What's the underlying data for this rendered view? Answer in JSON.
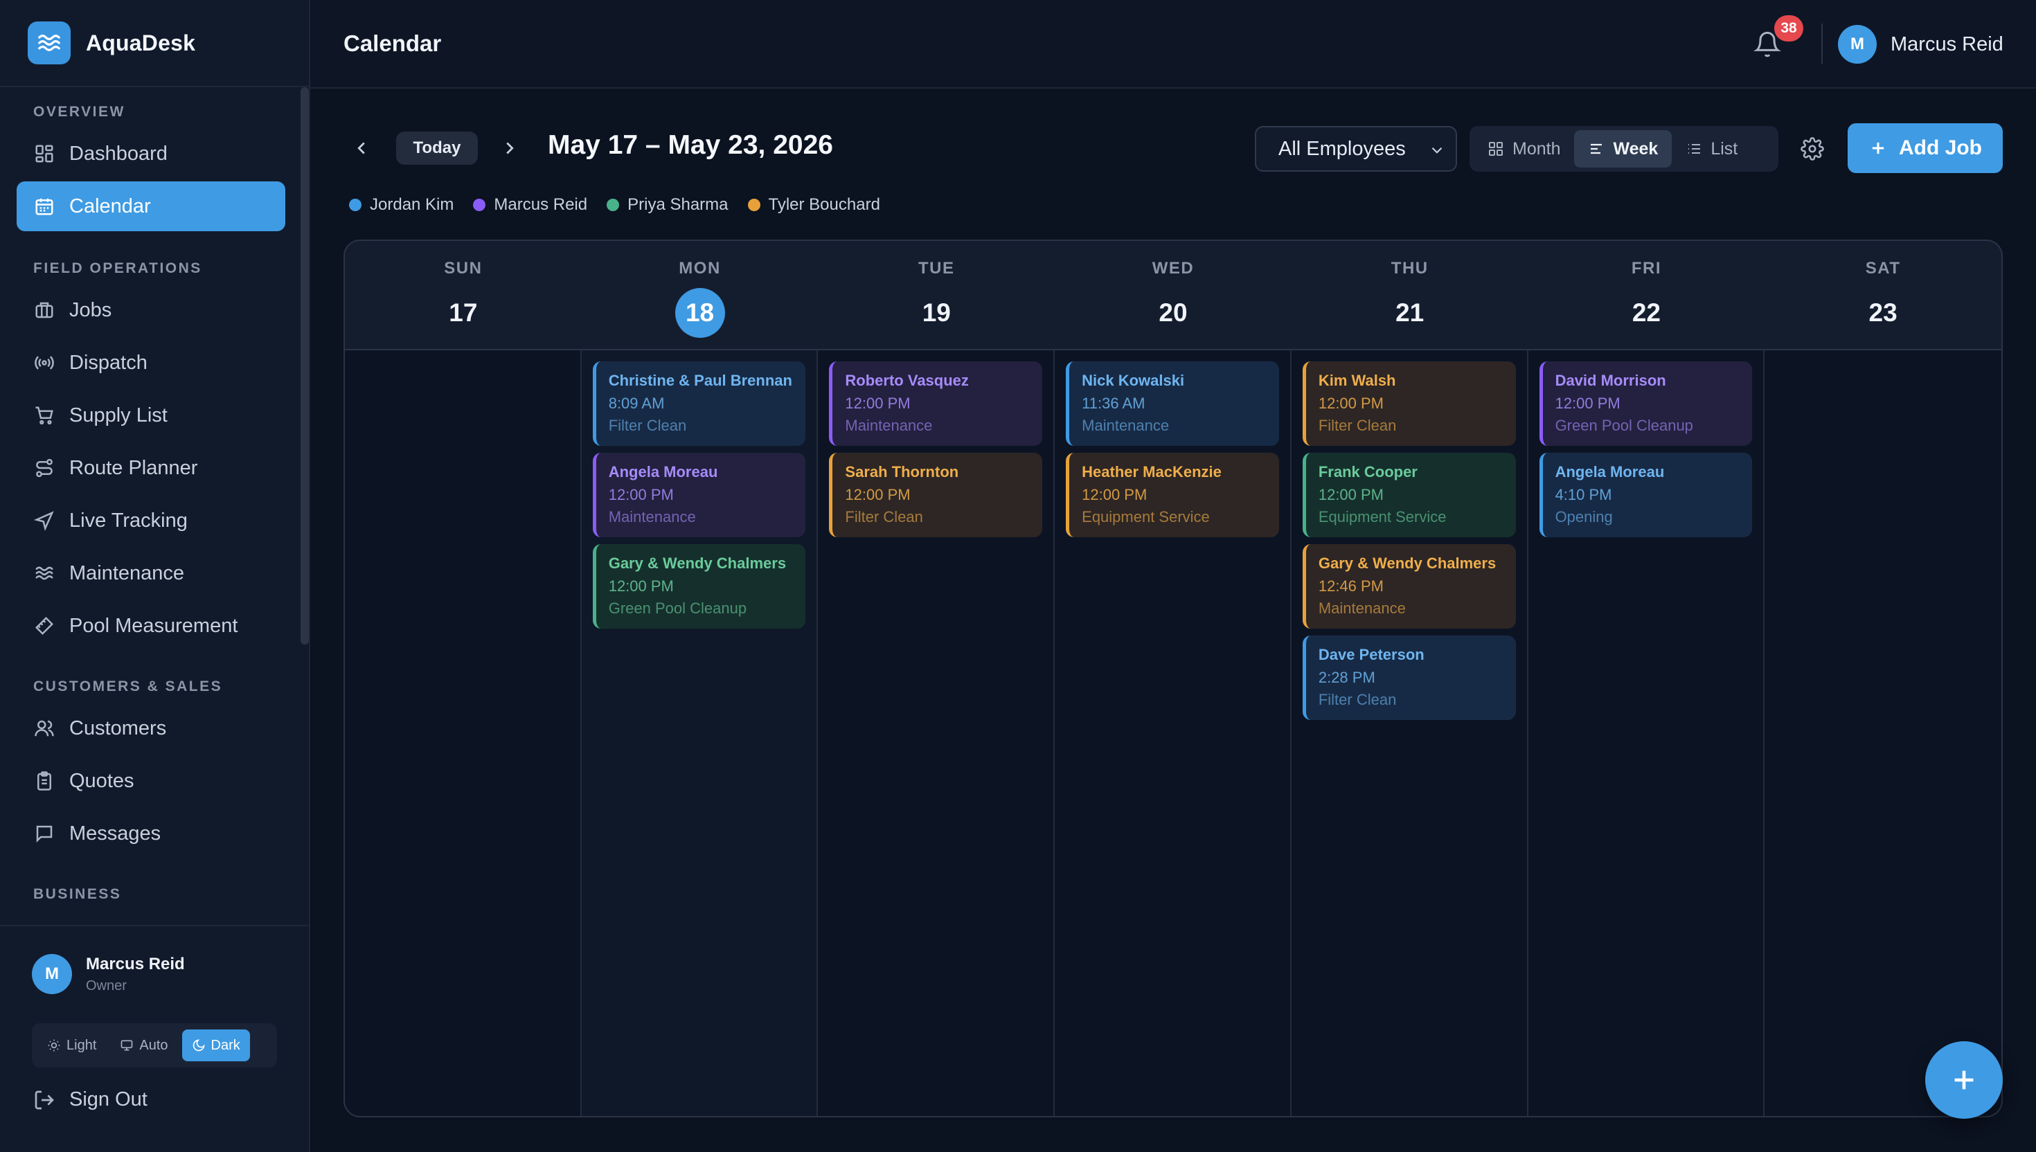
{
  "app": {
    "name": "AquaDesk",
    "page_title": "Calendar"
  },
  "colors": {
    "accent": "#3f9be3",
    "badge": "#e5484d",
    "jordan": "#3f9be3",
    "marcus": "#8b5cf6",
    "priya": "#48b28a",
    "tyler": "#e8a13a"
  },
  "sidebar": {
    "sections": [
      {
        "title": "OVERVIEW",
        "items": [
          {
            "label": "Dashboard",
            "icon": "dashboard-icon"
          },
          {
            "label": "Calendar",
            "icon": "calendar-icon",
            "active": true
          }
        ]
      },
      {
        "title": "FIELD OPERATIONS",
        "items": [
          {
            "label": "Jobs",
            "icon": "briefcase-icon"
          },
          {
            "label": "Dispatch",
            "icon": "broadcast-icon"
          },
          {
            "label": "Supply List",
            "icon": "cart-icon"
          },
          {
            "label": "Route Planner",
            "icon": "route-icon"
          },
          {
            "label": "Live Tracking",
            "icon": "navigation-icon"
          },
          {
            "label": "Maintenance",
            "icon": "waves-icon"
          },
          {
            "label": "Pool Measurement",
            "icon": "ruler-icon"
          }
        ]
      },
      {
        "title": "CUSTOMERS & SALES",
        "items": [
          {
            "label": "Customers",
            "icon": "users-icon"
          },
          {
            "label": "Quotes",
            "icon": "clipboard-icon"
          },
          {
            "label": "Messages",
            "icon": "message-icon"
          }
        ]
      },
      {
        "title": "BUSINESS",
        "items": []
      }
    ],
    "user": {
      "initial": "M",
      "name": "Marcus Reid",
      "role": "Owner"
    },
    "theme": {
      "options": [
        "Light",
        "Auto",
        "Dark"
      ],
      "selected": "Dark"
    },
    "sign_out": "Sign Out"
  },
  "topbar": {
    "notifications": "38",
    "user_initial": "M",
    "user_name": "Marcus Reid"
  },
  "toolbar": {
    "today": "Today",
    "range": "May 17 – May 23, 2026",
    "employee_filter": "All Employees",
    "views": [
      "Month",
      "Week",
      "List"
    ],
    "selected_view": "Week",
    "add_job": "Add Job"
  },
  "legend": [
    {
      "name": "Jordan Kim",
      "color": "#3f9be3"
    },
    {
      "name": "Marcus Reid",
      "color": "#8b5cf6"
    },
    {
      "name": "Priya Sharma",
      "color": "#48b28a"
    },
    {
      "name": "Tyler Bouchard",
      "color": "#e8a13a"
    }
  ],
  "calendar": {
    "days": [
      {
        "name": "SUN",
        "num": "17"
      },
      {
        "name": "MON",
        "num": "18",
        "today": true
      },
      {
        "name": "TUE",
        "num": "19"
      },
      {
        "name": "WED",
        "num": "20"
      },
      {
        "name": "THU",
        "num": "21"
      },
      {
        "name": "FRI",
        "num": "22"
      },
      {
        "name": "SAT",
        "num": "23"
      }
    ],
    "events": [
      [],
      [
        {
          "name": "Christine & Paul Brennan",
          "time": "8:09 AM",
          "type": "Filter Clean",
          "color": "blue"
        },
        {
          "name": "Angela Moreau",
          "time": "12:00 PM",
          "type": "Maintenance",
          "color": "purple"
        },
        {
          "name": "Gary & Wendy Chalmers",
          "time": "12:00 PM",
          "type": "Green Pool Cleanup",
          "color": "green"
        }
      ],
      [
        {
          "name": "Roberto Vasquez",
          "time": "12:00 PM",
          "type": "Maintenance",
          "color": "purple"
        },
        {
          "name": "Sarah Thornton",
          "time": "12:00 PM",
          "type": "Filter Clean",
          "color": "orange"
        }
      ],
      [
        {
          "name": "Nick Kowalski",
          "time": "11:36 AM",
          "type": "Maintenance",
          "color": "blue"
        },
        {
          "name": "Heather MacKenzie",
          "time": "12:00 PM",
          "type": "Equipment Service",
          "color": "orange"
        }
      ],
      [
        {
          "name": "Kim Walsh",
          "time": "12:00 PM",
          "type": "Filter Clean",
          "color": "orange"
        },
        {
          "name": "Frank Cooper",
          "time": "12:00 PM",
          "type": "Equipment Service",
          "color": "green"
        },
        {
          "name": "Gary & Wendy Chalmers",
          "time": "12:46 PM",
          "type": "Maintenance",
          "color": "orange"
        },
        {
          "name": "Dave Peterson",
          "time": "2:28 PM",
          "type": "Filter Clean",
          "color": "blue"
        }
      ],
      [
        {
          "name": "David Morrison",
          "time": "12:00 PM",
          "type": "Green Pool Cleanup",
          "color": "purple"
        },
        {
          "name": "Angela Moreau",
          "time": "4:10 PM",
          "type": "Opening",
          "color": "blue"
        }
      ],
      []
    ]
  }
}
